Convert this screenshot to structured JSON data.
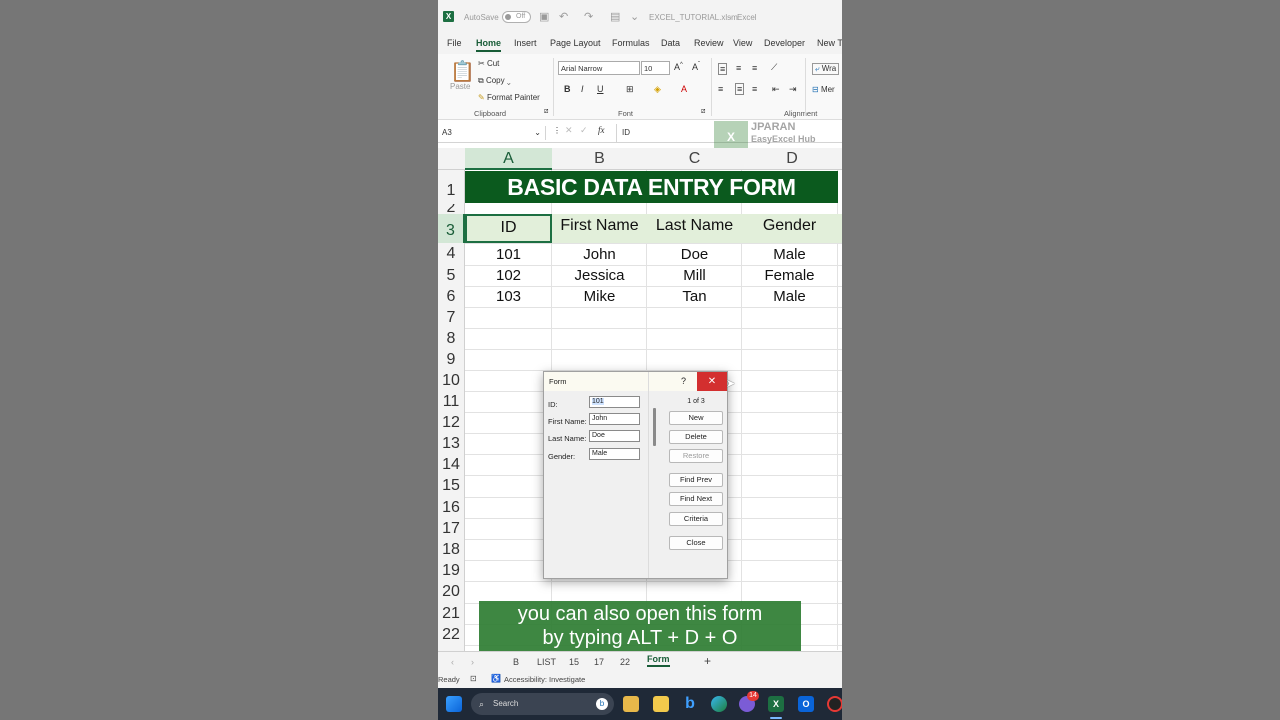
{
  "titlebar": {
    "autosave": "AutoSave",
    "toggle": "Off",
    "filename": "EXCEL_TUTORIAL.xlsm",
    "app": "Excel",
    "sep": "-"
  },
  "ribbon_tabs": [
    "File",
    "Home",
    "Insert",
    "Page Layout",
    "Formulas",
    "Data",
    "Review",
    "View",
    "Developer",
    "New T"
  ],
  "clipboard": {
    "paste": "Paste",
    "cut": "Cut",
    "copy": "Copy",
    "format_painter": "Format Painter",
    "label": "Clipboard"
  },
  "font": {
    "name": "Arial Narrow",
    "size": "10",
    "label": "Font"
  },
  "alignment": {
    "wrap": "Wra",
    "merge": "Mer",
    "label": "Alignment"
  },
  "formula_bar": {
    "name_box": "A3",
    "fx": "fx",
    "value": "ID"
  },
  "watermark": {
    "line1": "JPARAN",
    "line2": "EasyExcel Hub"
  },
  "columns": [
    "A",
    "B",
    "C",
    "D"
  ],
  "rows": [
    "1",
    "2",
    "3",
    "4",
    "5",
    "6",
    "7",
    "8",
    "9",
    "10",
    "11",
    "12",
    "13",
    "14",
    "15",
    "16",
    "17",
    "18",
    "19",
    "20",
    "21",
    "22"
  ],
  "sheet": {
    "title": "BASIC DATA ENTRY FORM",
    "headers": [
      "ID",
      "First Name",
      "Last Name",
      "Gender"
    ],
    "records": [
      [
        "101",
        "John",
        "Doe",
        "Male"
      ],
      [
        "102",
        "Jessica",
        "Mill",
        "Female"
      ],
      [
        "103",
        "Mike",
        "Tan",
        "Male"
      ]
    ]
  },
  "dialog": {
    "title": "Form",
    "help": "?",
    "close_glyph": "✕",
    "record_counter": "1 of 3",
    "fields": [
      {
        "label": "ID:",
        "value": "101"
      },
      {
        "label": "First Name:",
        "value": "John"
      },
      {
        "label": "Last Name:",
        "value": "Doe"
      },
      {
        "label": "Gender:",
        "value": "Male"
      }
    ],
    "buttons": {
      "new": "New",
      "delete": "Delete",
      "restore": "Restore",
      "find_prev": "Find Prev",
      "find_next": "Find Next",
      "criteria": "Criteria",
      "close": "Close"
    }
  },
  "caption": {
    "line1": "you can also open this form",
    "line2": "by typing ALT + D + O"
  },
  "sheet_tabs": [
    "B",
    "LIST",
    "15",
    "17",
    "22",
    "Form"
  ],
  "sheet_add": "+",
  "status": {
    "ready": "Ready",
    "accessibility": "Accessibility: Investigate"
  },
  "taskbar": {
    "search": "Search",
    "badge": "14"
  },
  "colors": {
    "excel_green": "#1d6f42",
    "title_bg": "#0b5a1e",
    "header_bg": "#e2efda",
    "caption_bg": "#2e7d32",
    "close_red": "#d32f2f"
  }
}
